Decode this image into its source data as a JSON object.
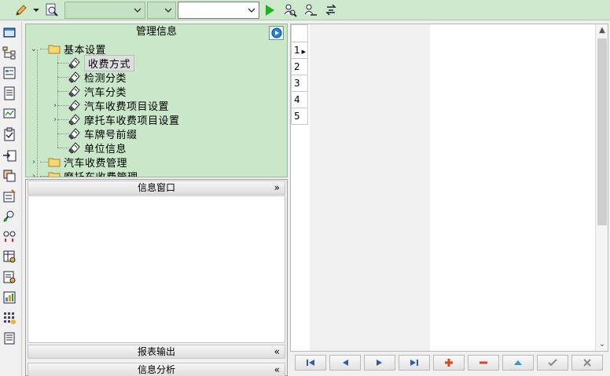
{
  "toolbar": {
    "icons": [
      "edit-pencil-icon",
      "dropdown-arrow-icon",
      "search-doc-icon",
      "run-icon",
      "find-user-icon",
      "find-next-icon",
      "refresh-icon"
    ],
    "combo1_value": "",
    "combo2_value": "",
    "combo3_value": ""
  },
  "left_toolbar": {
    "icons": [
      "window-icon",
      "tree-structure-icon",
      "list-card-icon",
      "document-icon",
      "chart-monitor-icon",
      "clipboard-icon",
      "import-icon",
      "grid-layers-icon",
      "form-edit-icon",
      "user-search-icon",
      "link-icon",
      "table-settings-icon",
      "doc-edit-icon",
      "chart-doc-icon",
      "grid-dots-icon",
      "printer-icon"
    ]
  },
  "mgmt": {
    "title": "管理信息",
    "tree": [
      {
        "label": "基本设置",
        "level": 0,
        "expanded": true,
        "type": "folder"
      },
      {
        "label": "收费方式",
        "level": 1,
        "type": "item",
        "selected": true
      },
      {
        "label": "检测分类",
        "level": 1,
        "type": "item"
      },
      {
        "label": "汽车分类",
        "level": 1,
        "type": "item"
      },
      {
        "label": "汽车收费项目设置",
        "level": 1,
        "type": "item",
        "expandable": true
      },
      {
        "label": "摩托车收费项目设置",
        "level": 1,
        "type": "item",
        "expandable": true
      },
      {
        "label": "车牌号前缀",
        "level": 1,
        "type": "item"
      },
      {
        "label": "单位信息",
        "level": 1,
        "type": "item"
      },
      {
        "label": "汽车收费管理",
        "level": 0,
        "expanded": false,
        "type": "folder"
      },
      {
        "label": "摩托车收费管理",
        "level": 0,
        "expanded": false,
        "type": "folder"
      }
    ]
  },
  "info": {
    "window_label": "信息窗口",
    "report_label": "报表输出",
    "analysis_label": "信息分析"
  },
  "grid": {
    "rows": [
      "1",
      "2",
      "3",
      "4",
      "5"
    ]
  },
  "nav": {
    "buttons": [
      "first-record-icon",
      "prev-record-icon",
      "next-record-icon",
      "last-record-icon",
      "add-record-icon",
      "delete-record-icon",
      "edit-record-icon",
      "save-record-icon",
      "cancel-record-icon"
    ]
  },
  "colors": {
    "panel_green": "#c9e7c9",
    "toolbar_green": "#cfe9cf"
  }
}
